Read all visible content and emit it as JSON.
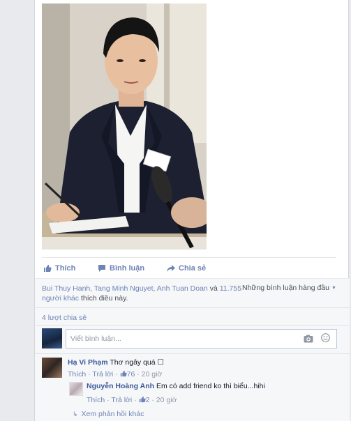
{
  "post": {
    "photo_alt": "man in suit at press conference with microphones"
  },
  "actions": {
    "like_label": "Thích",
    "comment_label": "Bình luận",
    "share_label": "Chia sẻ"
  },
  "likes": {
    "names": "Bui Thuy Hanh, Tang Minh Nguyet, Anh Tuan Doan",
    "and": "và",
    "others": "11.755 người khác",
    "suffix": "thích điều này.",
    "top_comments_label": "Những bình luận hàng đầu"
  },
  "shares": {
    "label": "4 lượt chia sẻ"
  },
  "composer": {
    "placeholder": "Viết bình luận..."
  },
  "comments": [
    {
      "author": "Hạ Vi Phạm",
      "text": "Thơ ngây quá ☐",
      "like": "Thích",
      "reply": "Trả lời",
      "likes": "76",
      "time": "20 giờ"
    }
  ],
  "replies": [
    {
      "author": "Nguyễn Hoàng Anh",
      "text": "Em có add friend ko thì biểu...hihi",
      "like": "Thích",
      "reply": "Trả lời",
      "likes": "2",
      "time": "20 giờ"
    }
  ],
  "more_replies_label": "Xem phản hồi khác",
  "colors": {
    "link": "#6d84b4",
    "author": "#3b5998",
    "panel": "#f6f7f9"
  }
}
